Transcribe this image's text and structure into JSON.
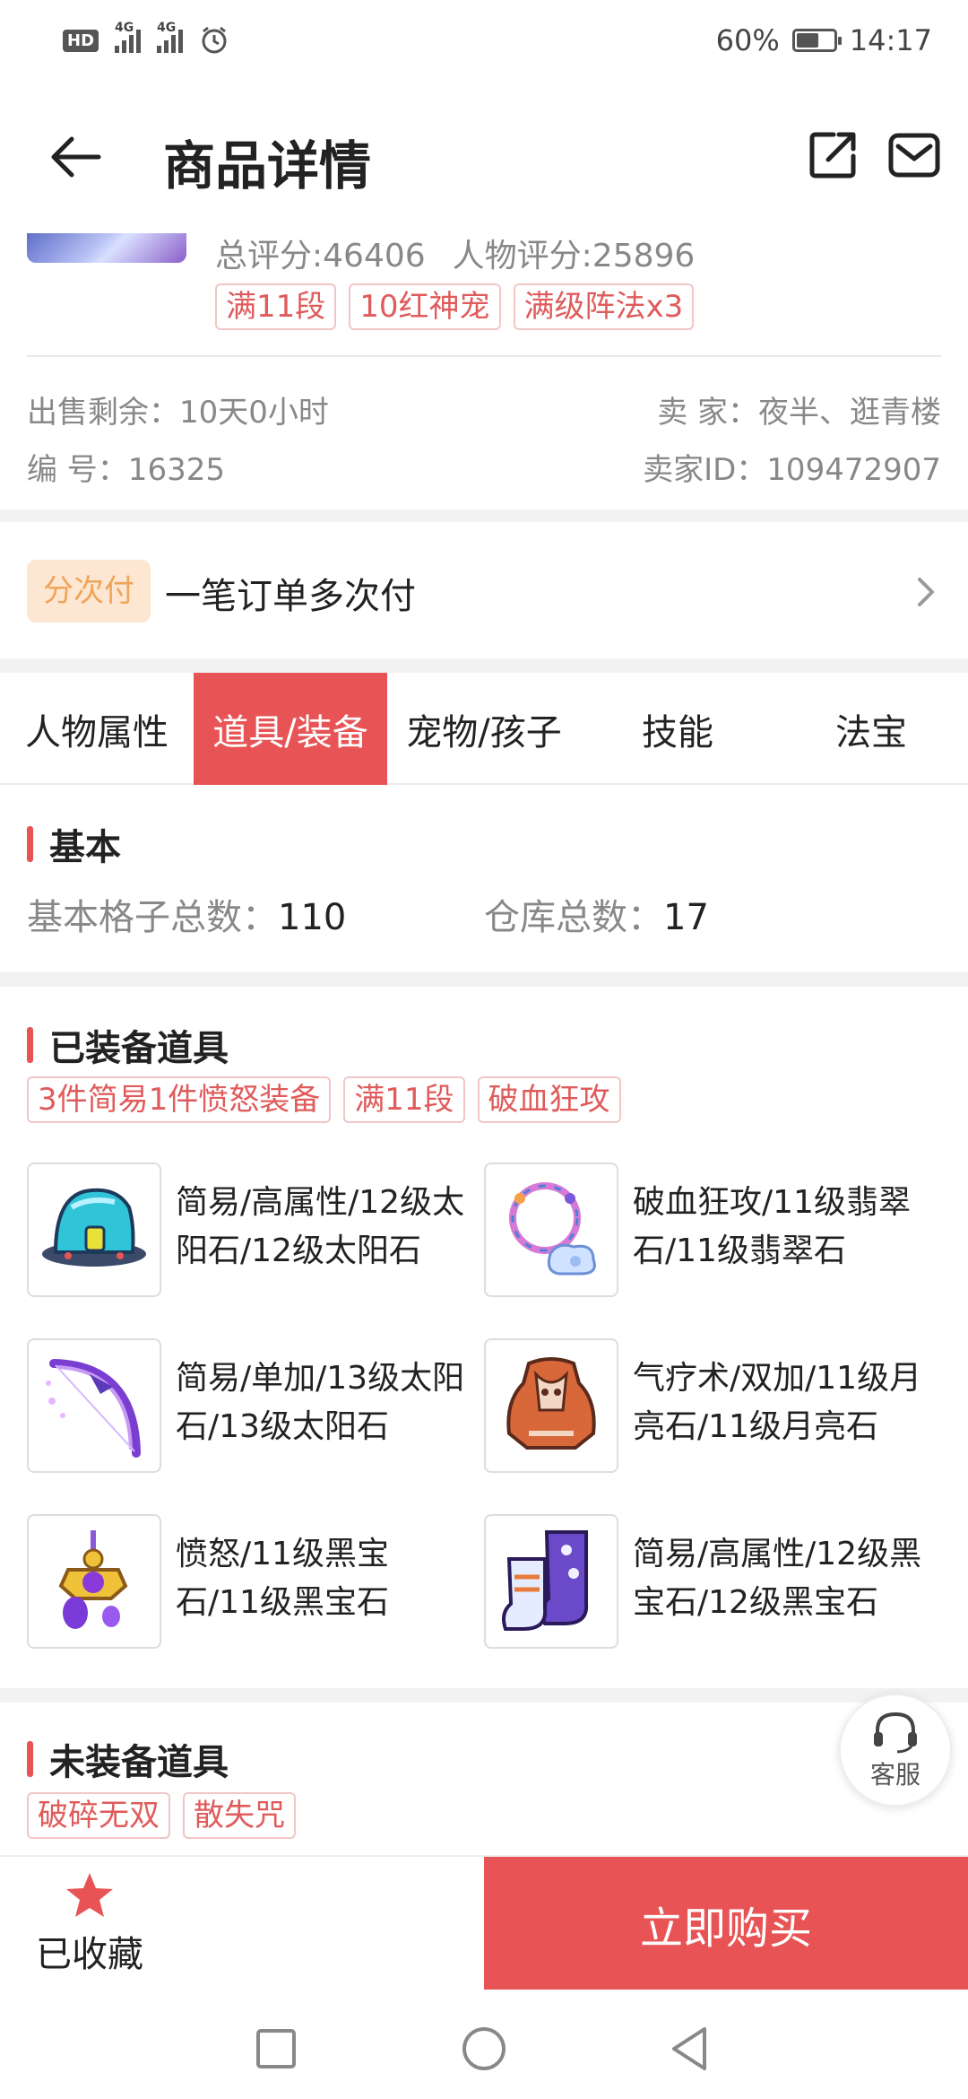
{
  "status_bar": {
    "hd": "HD",
    "net1": "4G",
    "net2": "4G",
    "battery": "60%",
    "time": "14:17"
  },
  "header": {
    "title": "商品详情"
  },
  "summary": {
    "total_score": "总评分:46406",
    "char_score": "人物评分:25896",
    "tags": [
      "满11段",
      "10红神宠",
      "满级阵法x3"
    ],
    "sale_remaining": "出售剩余：10天0小时",
    "seller": "卖  家：夜半、逛青楼",
    "number": "编  号：16325",
    "seller_id": "卖家ID：109472907"
  },
  "installment": {
    "badge": "分次付",
    "text": "一笔订单多次付"
  },
  "tabs": [
    "人物属性",
    "道具/装备",
    "宠物/孩子",
    "技能",
    "法宝"
  ],
  "active_tab": 1,
  "basic": {
    "title": "基本",
    "grid_label": "基本格子总数：",
    "grid_value": "110",
    "storage_label": "仓库总数：",
    "storage_value": "17"
  },
  "equipped": {
    "title": "已装备道具",
    "tags": [
      "3件简易1件愤怒装备",
      "满11段",
      "破血狂攻"
    ],
    "items": [
      {
        "icon": "helmet-icon",
        "desc": "简易/高属性/12级太阳石/12级太阳石"
      },
      {
        "icon": "necklace-icon",
        "desc": "破血狂攻/11级翡翠石/11级翡翠石"
      },
      {
        "icon": "bow-weapon-icon",
        "desc": "简易/单加/13级太阳石/13级太阳石"
      },
      {
        "icon": "armor-icon",
        "desc": "气疗术/双加/11级月亮石/11级月亮石"
      },
      {
        "icon": "belt-pendant-icon",
        "desc": "愤怒/11级黑宝石/11级黑宝石"
      },
      {
        "icon": "boots-icon",
        "desc": "简易/高属性/12级黑宝石/12级黑宝石"
      }
    ]
  },
  "unequipped": {
    "title": "未装备道具",
    "tags": [
      "破碎无双",
      "散失咒"
    ]
  },
  "support": {
    "label": "客服"
  },
  "bottom_bar": {
    "fav_label": "已收藏",
    "buy_label": "立即购买"
  },
  "colors": {
    "accent": "#e85456",
    "tag_text": "#e05b5b",
    "badge_bg": "#fde7d2",
    "badge_text": "#f0a35a"
  }
}
